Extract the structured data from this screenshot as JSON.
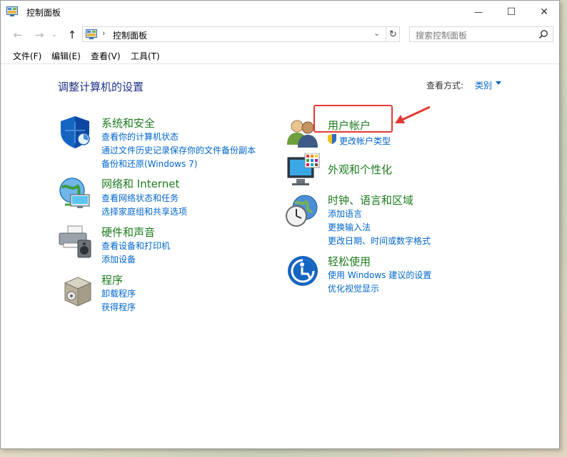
{
  "window": {
    "title": "控制面板",
    "minimize_glyph": "—",
    "maximize_glyph": "☐",
    "close_glyph": "✕"
  },
  "nav": {
    "back_glyph": "←",
    "forward_glyph": "→",
    "history_glyph": "⌄",
    "up_glyph": "↑",
    "address_separator": "›",
    "address_path": "控制面板",
    "address_dropdown_glyph": "⌄",
    "refresh_glyph": "↻",
    "search_placeholder": "搜索控制面板"
  },
  "menubar": [
    "文件(F)",
    "编辑(E)",
    "查看(V)",
    "工具(T)"
  ],
  "content": {
    "heading": "调整计算机的设置",
    "view_by_label": "查看方式:",
    "view_by_value": "类别"
  },
  "left_categories": [
    {
      "title": "系统和安全",
      "icon": "shield-icon",
      "links": [
        "查看你的计算机状态",
        "通过文件历史记录保存你的文件备份副本",
        "备份和还原(Windows 7)"
      ]
    },
    {
      "title": "网络和 Internet",
      "icon": "network-globe-icon",
      "links": [
        "查看网络状态和任务",
        "选择家庭组和共享选项"
      ]
    },
    {
      "title": "硬件和声音",
      "icon": "printer-speaker-icon",
      "links": [
        "查看设备和打印机",
        "添加设备"
      ]
    },
    {
      "title": "程序",
      "icon": "programs-box-icon",
      "links": [
        "卸载程序",
        "获得程序"
      ]
    }
  ],
  "right_categories": [
    {
      "title": "用户帐户",
      "icon": "users-icon",
      "links": [
        "更改帐户类型"
      ]
    },
    {
      "title": "外观和个性化",
      "icon": "monitor-palette-icon",
      "links": []
    },
    {
      "title": "时钟、语言和区域",
      "icon": "clock-globe-icon",
      "links": [
        "添加语言",
        "更换输入法",
        "更改日期、时间或数字格式"
      ]
    },
    {
      "title": "轻松使用",
      "icon": "ease-of-access-icon",
      "links": [
        "使用 Windows 建议的设置",
        "优化视觉显示"
      ]
    }
  ],
  "colors": {
    "category_title": "#1e7c1e",
    "link": "#0066cc",
    "heading": "#1e3287",
    "annotation": "#e53935"
  }
}
